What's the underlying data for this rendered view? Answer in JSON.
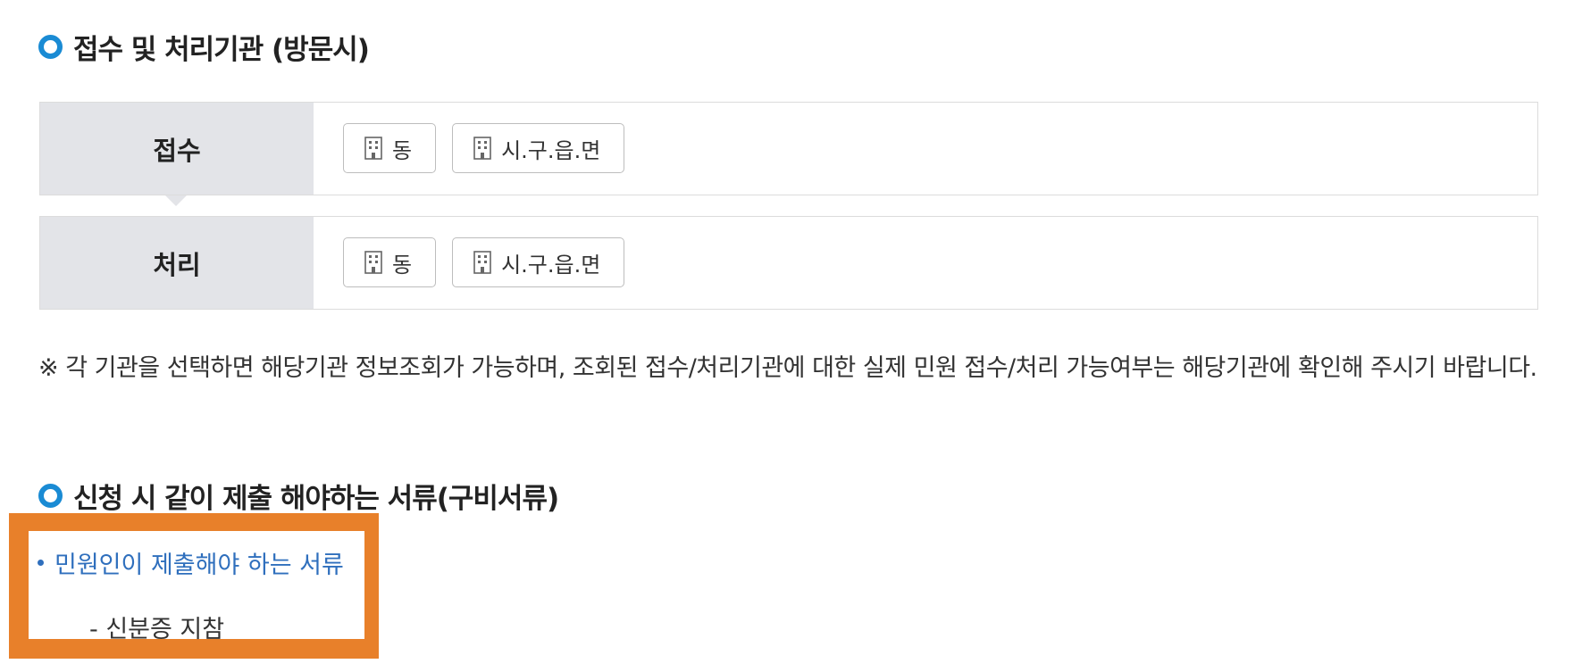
{
  "sections": {
    "offices_title": "접수 및 처리기관 (방문시)",
    "documents_title": "신청 시 같이 제출 해야하는 서류(구비서류)"
  },
  "rows": [
    {
      "label": "접수",
      "buttons": [
        {
          "label": "동",
          "icon": "building-icon"
        },
        {
          "label": "시.구.읍.면",
          "icon": "building-icon"
        }
      ]
    },
    {
      "label": "처리",
      "buttons": [
        {
          "label": "동",
          "icon": "building-icon"
        },
        {
          "label": "시.구.읍.면",
          "icon": "building-icon"
        }
      ]
    }
  ],
  "notice": "※ 각 기관을 선택하면 해당기관 정보조회가 가능하며, 조회된 접수/처리기관에 대한 실제 민원 접수/처리 가능여부는 해당기관에 확인해 주시기 바랍니다.",
  "documents": {
    "heading": "민원인이 제출해야 하는 서류",
    "item": "- 신분증 지참"
  },
  "colors": {
    "accent": "#1a8bd4",
    "row_header_bg": "#e3e4e8",
    "highlight": "#e8802a",
    "link_blue": "#2f6fbd"
  }
}
